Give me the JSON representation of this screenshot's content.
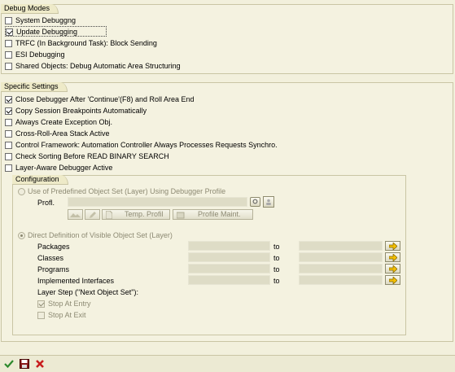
{
  "debug_modes": {
    "title": "Debug Modes",
    "items": [
      {
        "label": "System Debuggng",
        "checked": false
      },
      {
        "label": "Update Debugging",
        "checked": true
      },
      {
        "label": "TRFC (In Background Task): Block Sending",
        "checked": false
      },
      {
        "label": "ESI Debugging",
        "checked": false
      },
      {
        "label": "Shared Objects: Debug Automatic Area Structuring",
        "checked": false
      }
    ]
  },
  "specific_settings": {
    "title": "Specific Settings",
    "items": [
      {
        "label": "Close Debugger After 'Continue'(F8) and Roll Area End",
        "checked": true
      },
      {
        "label": "Copy Session Breakpoints Automatically",
        "checked": true
      },
      {
        "label": "Always Create Exception Obj.",
        "checked": false
      },
      {
        "label": "Cross-Roll-Area Stack Active",
        "checked": false
      },
      {
        "label": "Control Framework: Automation Controller Always Processes Requests Synchro.",
        "checked": false
      },
      {
        "label": "Check Sorting Before READ BINARY SEARCH",
        "checked": false
      },
      {
        "label": "Layer-Aware Debugger Active",
        "checked": false
      }
    ]
  },
  "configuration": {
    "title": "Configuration",
    "radio_profile_label": "Use of Predefined Object Set (Layer) Using Debugger Profile",
    "profile_label": "Profl.",
    "profile_value": "",
    "temp_profile_label": "Temp. Profil",
    "profile_maint_label": "Profile Maint.",
    "radio_direct_label": "Direct Definition of Visible Object Set (Layer)",
    "to_label": "to",
    "ranges": [
      {
        "label": "Packages"
      },
      {
        "label": "Classes"
      },
      {
        "label": "Programs"
      },
      {
        "label": "Implemented Interfaces"
      }
    ],
    "layer_step_label": "Layer Step (\"Next Object Set\"):",
    "stop_at_entry_label": "Stop At Entry",
    "stop_at_exit_label": "Stop At Exit"
  },
  "colors": {
    "background": "#f2f0dc",
    "arrow_yellow": "#f5c000",
    "ok_green": "#2d8a2d",
    "cancel_red": "#c81e1e"
  },
  "icons": [
    "check-icon",
    "save-icon",
    "cancel-icon",
    "multiple-selection-arrow-icon",
    "execute-icon",
    "search-icon"
  ]
}
